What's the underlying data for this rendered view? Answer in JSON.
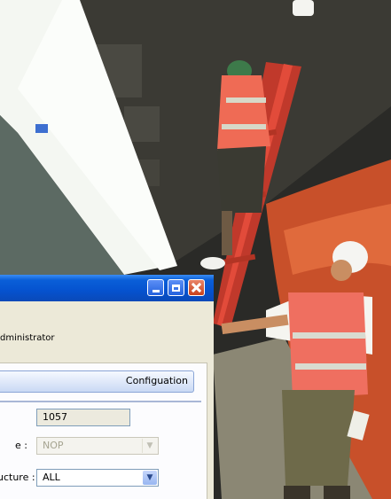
{
  "window": {
    "controls": {
      "minimize_icon": "minimize-icon",
      "maximize_icon": "maximize-icon",
      "close_icon": "close-icon"
    },
    "accent_color": "#0a5fd8"
  },
  "user_label": "dministrator",
  "panel": {
    "config_button_label": "Configuation"
  },
  "fields": {
    "id": {
      "value": "1057"
    },
    "type": {
      "label": "e :",
      "value": "NOP",
      "disabled": true
    },
    "structure": {
      "label": "ucture :",
      "value": "ALL"
    }
  }
}
